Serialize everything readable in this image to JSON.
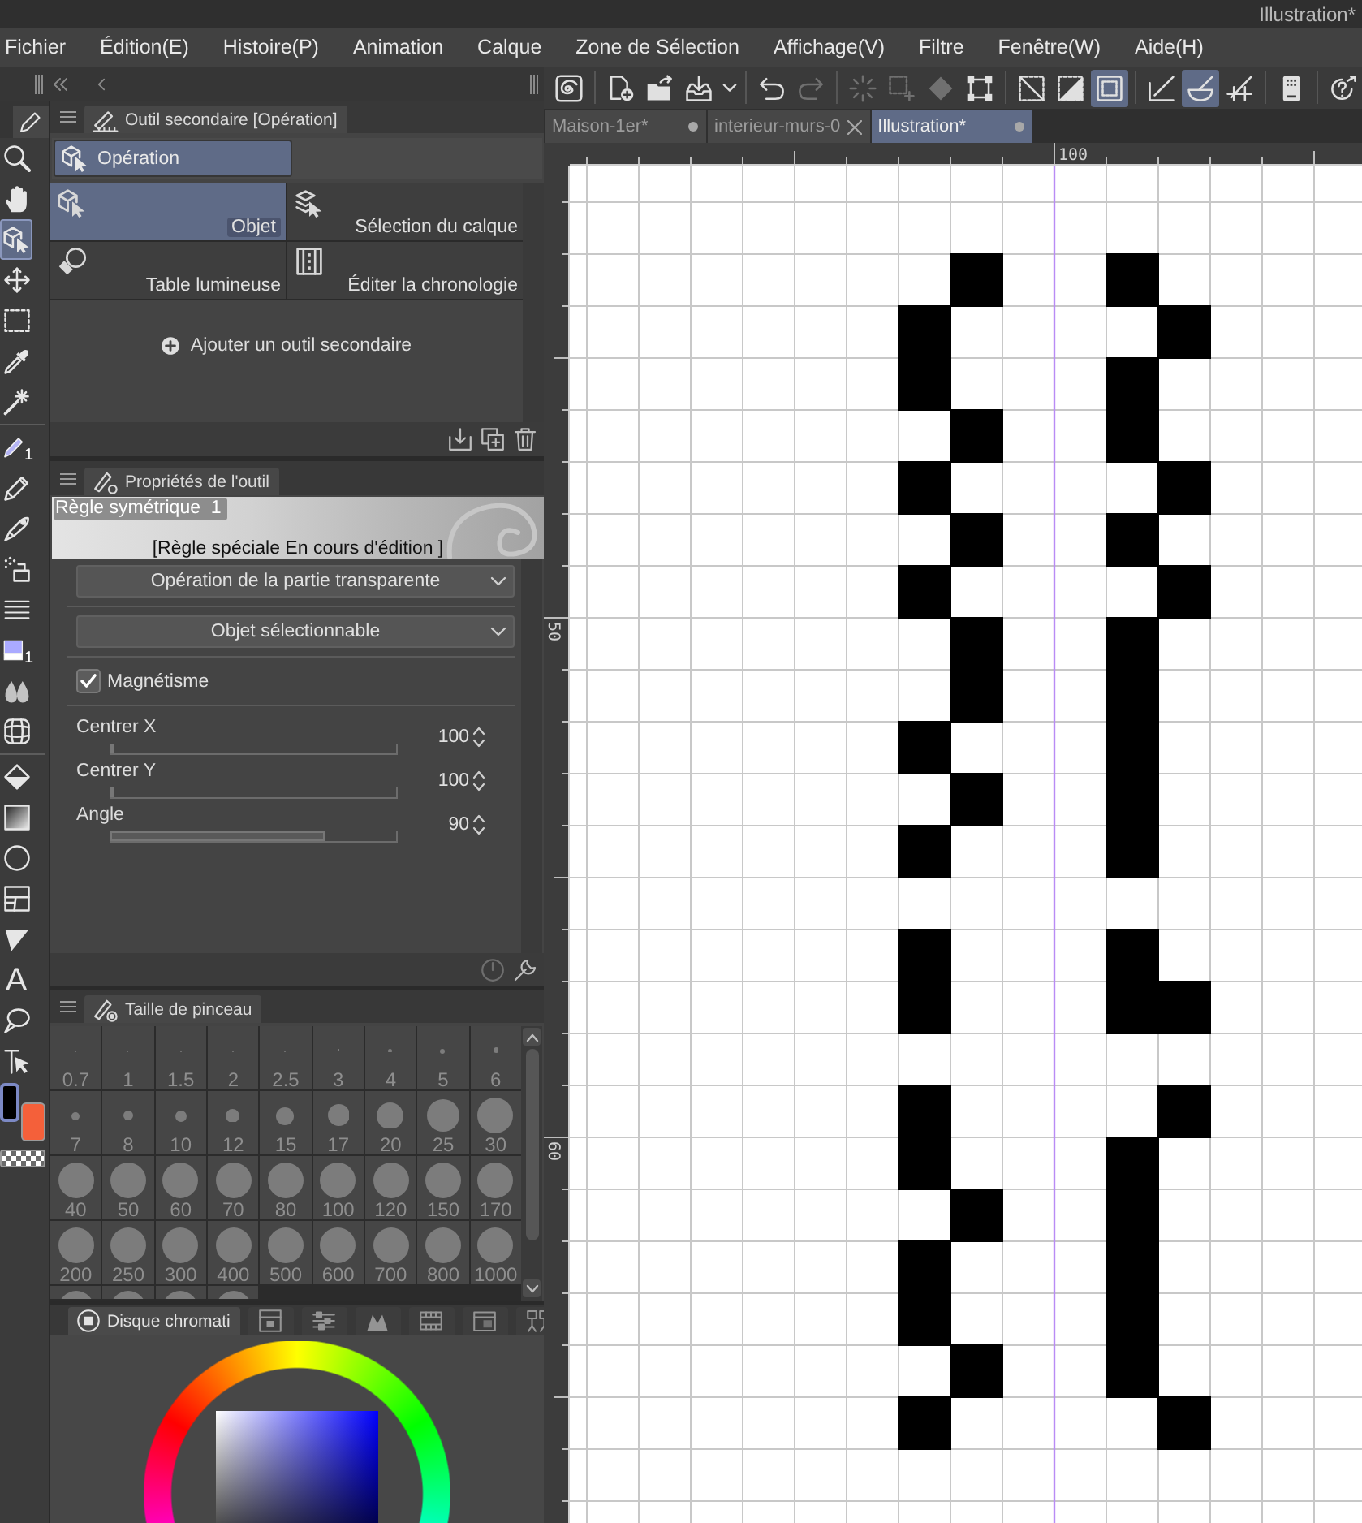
{
  "window": {
    "title": "Illustration*"
  },
  "menu": [
    "Fichier",
    "Édition(E)",
    "Histoire(P)",
    "Animation",
    "Calque",
    "Zone de Sélection",
    "Affichage(V)",
    "Filtre",
    "Fenêtre(W)",
    "Aide(H)"
  ],
  "toolbar": {
    "groups": [
      {
        "tools": [
          {
            "kind": "zoom",
            "selected": false
          },
          {
            "kind": "hand",
            "selected": false
          },
          {
            "kind": "object",
            "selected": true
          },
          {
            "kind": "move",
            "selected": false
          },
          {
            "kind": "marquee",
            "selected": false
          },
          {
            "kind": "eyedropper",
            "selected": false
          },
          {
            "kind": "wand",
            "selected": false
          }
        ]
      },
      {
        "tools": [
          {
            "kind": "pen",
            "selected": false,
            "badge": "1"
          },
          {
            "kind": "pencil",
            "selected": false
          },
          {
            "kind": "brush",
            "selected": false
          },
          {
            "kind": "airbrush",
            "selected": false
          },
          {
            "kind": "lines",
            "selected": false
          },
          {
            "kind": "swatch",
            "selected": false,
            "badge": "1"
          },
          {
            "kind": "blend",
            "selected": false
          },
          {
            "kind": "mesh",
            "selected": false
          }
        ]
      },
      {
        "tools": [
          {
            "kind": "fill",
            "selected": false
          },
          {
            "kind": "gradient",
            "selected": false
          },
          {
            "kind": "ellipse",
            "selected": false
          },
          {
            "kind": "frame",
            "selected": false
          },
          {
            "kind": "ruler",
            "selected": false
          },
          {
            "kind": "text",
            "selected": false,
            "glyph": "A"
          },
          {
            "kind": "balloon",
            "selected": false
          },
          {
            "kind": "correct",
            "selected": false
          }
        ]
      }
    ],
    "colors": [
      {
        "color": "#000000",
        "selected": true
      },
      {
        "color": "#f4603a",
        "selected": false
      }
    ]
  },
  "command_bar": {
    "groups": [
      {
        "buttons": [
          {
            "kind": "logo",
            "selected": false,
            "disabled": false
          }
        ]
      },
      {
        "buttons": [
          {
            "kind": "new",
            "selected": false,
            "disabled": false
          },
          {
            "kind": "open",
            "selected": false,
            "disabled": false
          },
          {
            "kind": "export",
            "selected": false,
            "disabled": false
          },
          {
            "kind": "caret",
            "selected": false,
            "disabled": false
          }
        ]
      },
      {
        "buttons": [
          {
            "kind": "undo",
            "selected": false,
            "disabled": false
          },
          {
            "kind": "redo",
            "selected": false,
            "disabled": true
          }
        ]
      },
      {
        "buttons": [
          {
            "kind": "spinner",
            "selected": false,
            "disabled": true
          },
          {
            "kind": "selection-launcher",
            "selected": false,
            "disabled": true
          },
          {
            "kind": "fill-selection",
            "selected": false,
            "disabled": true
          },
          {
            "kind": "transform",
            "selected": false,
            "disabled": false
          }
        ]
      },
      {
        "buttons": [
          {
            "kind": "clear-selection",
            "selected": false,
            "disabled": false
          },
          {
            "kind": "half-selection",
            "selected": false,
            "disabled": false
          },
          {
            "kind": "frame-selection",
            "selected": true,
            "disabled": false
          }
        ]
      },
      {
        "buttons": [
          {
            "kind": "ruler-snap",
            "selected": false,
            "disabled": false
          },
          {
            "kind": "special-ruler-snap",
            "selected": true,
            "disabled": false
          },
          {
            "kind": "grid-snap",
            "selected": false,
            "disabled": false
          }
        ]
      },
      {
        "buttons": [
          {
            "kind": "device",
            "selected": false,
            "disabled": false
          }
        ]
      },
      {
        "buttons": [
          {
            "kind": "help",
            "selected": false,
            "disabled": false
          }
        ]
      }
    ]
  },
  "document_tabs": [
    {
      "label": "Maison-1er*",
      "kind": "modified",
      "selected": false
    },
    {
      "label": "interieur-murs-0",
      "kind": "closable",
      "selected": false
    },
    {
      "label": "Illustration*",
      "kind": "modified",
      "selected": true
    }
  ],
  "rulers": {
    "horizontal": [
      "100"
    ],
    "vertical": [
      "50",
      "60"
    ]
  },
  "sub_tool_panel": {
    "title": "Outil secondaire [Opération]",
    "groups": [
      {
        "label": "Opération",
        "selected": true
      }
    ],
    "tools": [
      {
        "kind": "object",
        "label": "Objet",
        "selected": true
      },
      {
        "kind": "layer-select",
        "label": "Sélection du calque",
        "selected": false
      },
      {
        "kind": "light-table",
        "label": "Table lumineuse",
        "selected": false
      },
      {
        "kind": "timeline",
        "label": "Éditer la chronologie",
        "selected": false
      }
    ],
    "add_label": "Ajouter un outil secondaire"
  },
  "tool_properties": {
    "title": "Propriétés de l'outil",
    "preview": {
      "name": "Règle symétrique  1",
      "caption": "[Règle spéciale En cours d'édition ]"
    },
    "dropdowns": [
      "Opération de la partie transparente",
      "Objet sélectionnable"
    ],
    "checkbox": {
      "label": "Magnétisme",
      "checked": true
    },
    "sliders": [
      {
        "label": "Centrer X",
        "value": "100",
        "level": 0
      },
      {
        "label": "Centrer Y",
        "value": "100",
        "level": 0
      },
      {
        "label": "Angle",
        "value": "90",
        "level": 0.75
      }
    ]
  },
  "brush_size_panel": {
    "title": "Taille de pinceau",
    "sizes": [
      "0.7",
      "1",
      "1.5",
      "2",
      "2.5",
      "3",
      "4",
      "5",
      "6",
      "7",
      "8",
      "10",
      "12",
      "15",
      "17",
      "20",
      "25",
      "30",
      "40",
      "50",
      "60",
      "70",
      "80",
      "100",
      "120",
      "150",
      "170",
      "200",
      "250",
      "300",
      "400",
      "500",
      "600",
      "700",
      "800",
      "1000"
    ]
  },
  "color_panel": {
    "tabs": [
      {
        "kind": "color-wheel",
        "label": "Disque chromati",
        "selected": true
      },
      {
        "kind": "color-set",
        "selected": false
      },
      {
        "kind": "sliders",
        "selected": false
      },
      {
        "kind": "intermediate",
        "selected": false
      },
      {
        "kind": "history",
        "selected": false
      },
      {
        "kind": "approximate",
        "selected": false
      },
      {
        "kind": "sub-view",
        "selected": false
      }
    ]
  }
}
